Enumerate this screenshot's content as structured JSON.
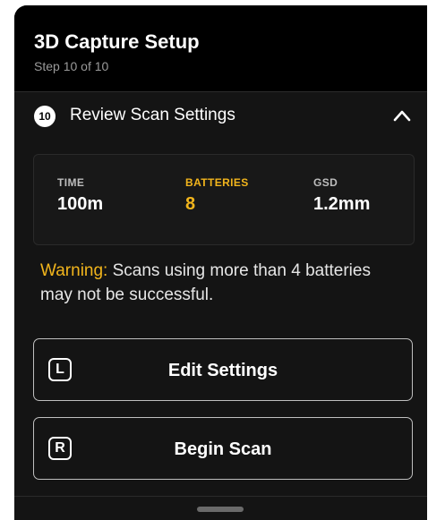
{
  "header": {
    "title": "3D Capture Setup",
    "subtitle": "Step 10 of 10"
  },
  "section": {
    "step_number": "10",
    "title": "Review Scan Settings",
    "toggle_icon": "chevron-up-icon"
  },
  "stats": [
    {
      "label": "TIME",
      "value": "100m"
    },
    {
      "label": "BATTERIES",
      "value": "8"
    },
    {
      "label": "GSD",
      "value": "1.2mm"
    }
  ],
  "warning": {
    "prefix": "Warning:",
    "text": " Scans using more than 4 batteries may not be successful."
  },
  "buttons": {
    "edit": {
      "key": "L",
      "label": "Edit Settings"
    },
    "begin": {
      "key": "R",
      "label": "Begin Scan"
    }
  },
  "colors": {
    "accent": "#f2b51c",
    "background": "#141414",
    "header_background": "#000000"
  }
}
